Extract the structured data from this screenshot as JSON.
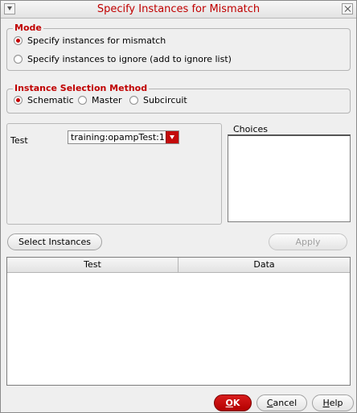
{
  "window": {
    "title": "Specify Instances for Mismatch"
  },
  "mode": {
    "group_title": "Mode",
    "options": [
      {
        "label": "Specify instances for mismatch",
        "checked": true
      },
      {
        "label": "Specify instances to ignore (add to ignore list)",
        "checked": false
      }
    ]
  },
  "selection_method": {
    "group_title": "Instance Selection Method",
    "options": [
      {
        "label": "Schematic",
        "checked": true
      },
      {
        "label": "Master",
        "checked": false
      },
      {
        "label": "Subcircuit",
        "checked": false
      }
    ]
  },
  "test_panel": {
    "label": "Test",
    "selected_value": "training:opampTest:1"
  },
  "choices": {
    "label": "Choices"
  },
  "actions": {
    "select_instances_label": "Select Instances",
    "apply_label": "Apply"
  },
  "table": {
    "columns": [
      "Test",
      "Data"
    ],
    "rows": []
  },
  "footer": {
    "ok_first": "O",
    "ok_rest": "K",
    "cancel_first": "C",
    "cancel_rest": "ancel",
    "help_first": "H",
    "help_rest": "elp"
  },
  "colors": {
    "accent": "#c00000",
    "primary_button": "#c30a0a"
  },
  "icons": {
    "window_menu": "window-menu-icon",
    "close": "close-icon",
    "dropdown": "chevron-down-icon"
  }
}
